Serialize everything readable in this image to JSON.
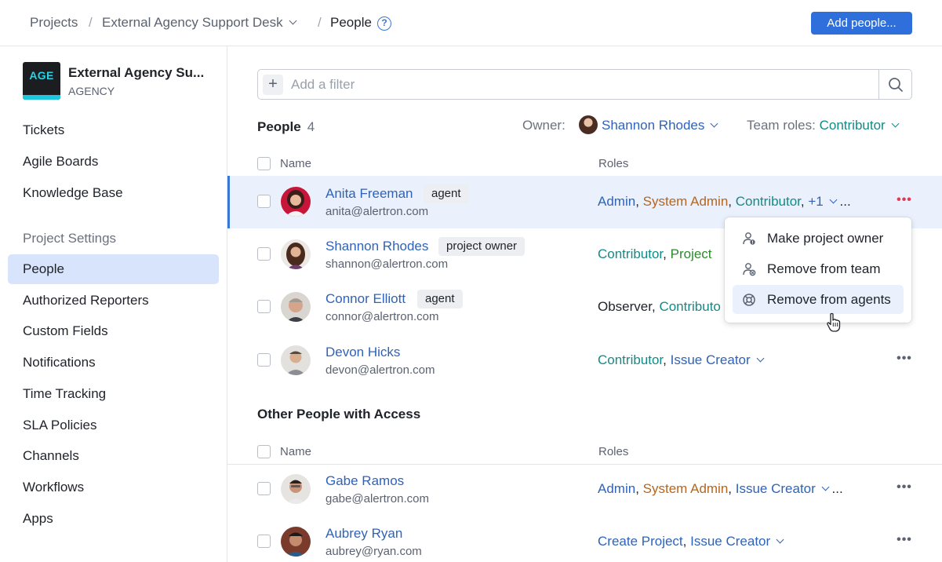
{
  "breadcrumb": {
    "projects": "Projects",
    "separator": "/",
    "project": "External Agency Support Desk",
    "current": "People"
  },
  "header": {
    "help_icon": "?",
    "add_people_label": "Add people..."
  },
  "sidebar": {
    "logo_text": "AGE",
    "project_name": "External Agency Su...",
    "project_type": "AGENCY",
    "items": [
      "Tickets",
      "Agile Boards",
      "Knowledge Base"
    ],
    "settings_title": "Project Settings",
    "settings_items": [
      "People",
      "Authorized Reporters",
      "Custom Fields",
      "Notifications",
      "Time Tracking",
      "SLA Policies",
      "Channels",
      "Workflows",
      "Apps"
    ]
  },
  "filter": {
    "plus": "+",
    "placeholder": "Add a filter"
  },
  "people": {
    "title": "People",
    "count": "4",
    "owner_label": "Owner:",
    "owner_value": "Shannon Rhodes",
    "team_roles_label": "Team roles:",
    "team_roles_value": "Contributor",
    "col_name": "Name",
    "col_roles": "Roles",
    "rows": [
      {
        "name": "Anita Freeman",
        "badge": "agent",
        "email": "anita@alertron.com",
        "roles": [
          {
            "text": "Admin",
            "sep": ", "
          },
          {
            "text": "System Admin",
            "sep": ", "
          },
          {
            "text": "Contributor",
            "sep": ", "
          },
          {
            "text": "+1",
            "sep": ""
          }
        ],
        "ellipsis": "..."
      },
      {
        "name": "Shannon Rhodes",
        "badge": "project owner",
        "email": "shannon@alertron.com",
        "roles": [
          {
            "text": "Contributor",
            "sep": ", "
          },
          {
            "text": "Project",
            "sep": ""
          }
        ]
      },
      {
        "name": "Connor Elliott",
        "badge": "agent",
        "email": "connor@alertron.com",
        "roles": [
          {
            "text": "Observer",
            "sep": ", "
          },
          {
            "text": "Contributo",
            "sep": ""
          }
        ]
      },
      {
        "name": "Devon Hicks",
        "badge": "",
        "email": "devon@alertron.com",
        "roles": [
          {
            "text": "Contributor",
            "sep": ", "
          },
          {
            "text": "Issue Creator",
            "sep": ""
          }
        ]
      }
    ]
  },
  "other": {
    "title": "Other People with Access",
    "col_name": "Name",
    "col_roles": "Roles",
    "rows": [
      {
        "name": "Gabe Ramos",
        "email": "gabe@alertron.com",
        "roles": [
          {
            "text": "Admin",
            "sep": ", "
          },
          {
            "text": "System Admin",
            "sep": ", "
          },
          {
            "text": "Issue Creator",
            "sep": ""
          }
        ],
        "ellipsis": "..."
      },
      {
        "name": "Aubrey Ryan",
        "email": "aubrey@ryan.com",
        "roles": [
          {
            "text": "Create Project",
            "sep": ", "
          },
          {
            "text": "Issue Creator",
            "sep": ""
          }
        ]
      }
    ]
  },
  "row_menu": {
    "dots": "•••",
    "items": [
      "Make project owner",
      "Remove from team",
      "Remove from agents"
    ]
  },
  "colors": {
    "accent": "#2f6fdb",
    "link": "#2f63b9",
    "role_orange": "#b5651d",
    "role_teal": "#148a86",
    "role_green": "#2d8a2d",
    "danger": "#e03a55"
  }
}
